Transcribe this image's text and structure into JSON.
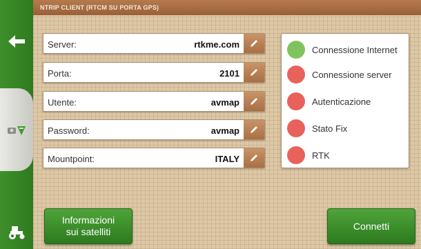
{
  "header": {
    "title": "NTRIP CLIENT (RTCM SU PORTA GPS)"
  },
  "sidebar": {
    "items": [
      {
        "icon": "back-arrow-icon"
      },
      {
        "icon": "gps-satellite-icon"
      },
      {
        "icon": "tractor-icon"
      }
    ]
  },
  "fields": [
    {
      "label": "Server:",
      "value": "rtkme.com"
    },
    {
      "label": "Porta:",
      "value": "2101"
    },
    {
      "label": "Utente:",
      "value": "avmap"
    },
    {
      "label": "Password:",
      "value": "avmap"
    },
    {
      "label": "Mountpoint:",
      "value": "ITALY"
    }
  ],
  "status": [
    {
      "label": "Connessione Internet",
      "state": "ok",
      "color": "#7fc35e"
    },
    {
      "label": "Connessione server",
      "state": "error",
      "color": "#e8625b"
    },
    {
      "label": "Autenticazione",
      "state": "error",
      "color": "#e8625b"
    },
    {
      "label": "Stato Fix",
      "state": "error",
      "color": "#e8625b"
    },
    {
      "label": "RTK",
      "state": "error",
      "color": "#e8625b"
    }
  ],
  "buttons": {
    "satellite_info_line1": "Informazioni",
    "satellite_info_line2": "sui satelliti",
    "connect": "Connetti"
  },
  "colors": {
    "accent_green": "#3f8f2c",
    "title_brown": "#a96f43",
    "ok": "#7fc35e",
    "error": "#e8625b"
  }
}
